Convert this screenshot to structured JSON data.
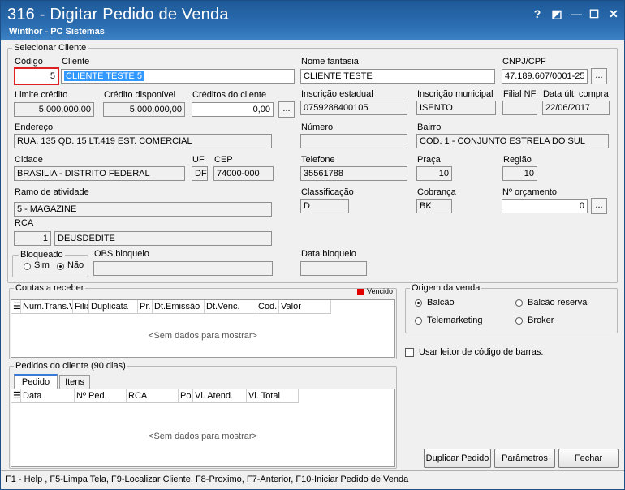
{
  "window": {
    "title": "316 - Digitar Pedido de Venda",
    "subtitle": "Winthor - PC Sistemas",
    "controls": {
      "help": "?",
      "restore": "◩",
      "minimize": "—",
      "maximize": "☐",
      "close": "✕"
    }
  },
  "cliente": {
    "group_title": "Selecionar Cliente",
    "codigo_label": "Código",
    "codigo_value": "5",
    "cliente_label": "Cliente",
    "cliente_value": "CLIENTE TESTE 5",
    "fantasia_label": "Nome fantasia",
    "fantasia_value": "CLIENTE TESTE",
    "cnpj_label": "CNPJ/CPF",
    "cnpj_value": "47.189.607/0001-25",
    "limite_label": "Limite crédito",
    "limite_value": "5.000.000,00",
    "disponivel_label": "Crédito disponível",
    "disponivel_value": "5.000.000,00",
    "creditos_label": "Créditos do cliente",
    "creditos_value": "0,00",
    "ie_label": "Inscrição estadual",
    "ie_value": "0759288400105",
    "im_label": "Inscrição municipal",
    "im_value": "ISENTO",
    "filialnf_label": "Filial NF",
    "filialnf_value": "",
    "dataultcompra_label": "Data últ. compra",
    "dataultcompra_value": "22/06/2017",
    "endereco_label": "Endereço",
    "endereco_value": "RUA. 135 QD. 15 LT.419 EST. COMERCIAL",
    "numero_label": "Número",
    "numero_value": "",
    "bairro_label": "Bairro",
    "bairro_value": "COD. 1 - CONJUNTO ESTRELA DO SUL",
    "cidade_label": "Cidade",
    "cidade_value": "BRASILIA - DISTRITO FEDERAL",
    "uf_label": "UF",
    "uf_value": "DF",
    "cep_label": "CEP",
    "cep_value": "74000-000",
    "telefone_label": "Telefone",
    "telefone_value": "35561788",
    "praca_label": "Praça",
    "praca_value": "10",
    "regiao_label": "Região",
    "regiao_value": "10",
    "ramo_label": "Ramo de atividade",
    "ramo_value": "5 - MAGAZINE",
    "classificacao_label": "Classificação",
    "classificacao_value": "D",
    "cobranca_label": "Cobrança",
    "cobranca_value": "BK",
    "orcamento_label": "Nº orçamento",
    "orcamento_value": "0",
    "rca_label": "RCA",
    "rca_code": "1",
    "rca_name": "DEUSDEDITE",
    "bloqueado_label": "Bloqueado",
    "sim_label": "Sim",
    "nao_label": "Não",
    "obs_label": "OBS bloqueio",
    "obs_value": "",
    "databloq_label": "Data bloqueio",
    "databloq_value": "",
    "ellipsis": "..."
  },
  "contas": {
    "group_title": "Contas a receber",
    "vencido_label": "Vencido",
    "columns": [
      "Num.Trans.V",
      "Filia",
      "Duplicata",
      "Pr.",
      "Dt.Emissão",
      "Dt.Venc.",
      "Cod.",
      "Valor"
    ],
    "empty": "<Sem dados para mostrar>"
  },
  "origem": {
    "group_title": "Origem da venda",
    "balcao": "Balcão",
    "balcao_reserva": "Balcão reserva",
    "telemarketing": "Telemarketing",
    "broker": "Broker",
    "selected": "balcao"
  },
  "leitor_label": "Usar leitor de código de barras.",
  "pedidos": {
    "group_title": "Pedidos do cliente (90 dias)",
    "tabs": [
      "Pedido",
      "Itens"
    ],
    "columns": [
      "Data",
      "Nº Ped.",
      "RCA",
      "Pos",
      "Vl. Atend.",
      "Vl. Total"
    ],
    "empty": "<Sem dados para mostrar>"
  },
  "buttons": {
    "duplicar": "Duplicar Pedido",
    "parametros": "Parâmetros",
    "fechar": "Fechar"
  },
  "status": "F1 - Help , F5-Limpa Tela, F9-Localizar Cliente, F8-Proximo, F7-Anterior, F10-Iniciar Pedido de Venda",
  "colors": {
    "title_bg": "#2a6cb0",
    "selection": "#3399ff",
    "highlight_border": "#e02020",
    "vencido": "#e00000"
  }
}
